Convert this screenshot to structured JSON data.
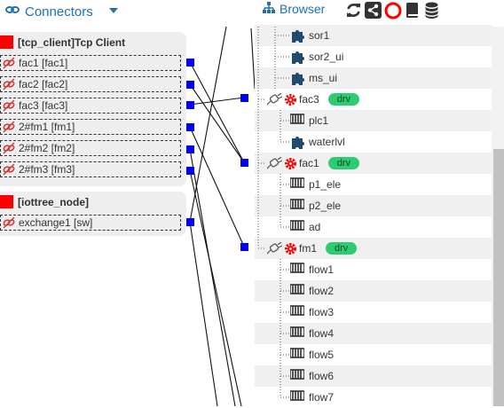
{
  "header": {
    "connectors_label": "Connectors",
    "browser_label": "Browser"
  },
  "connectors": [
    {
      "title": "[tcp_client]Tcp Client",
      "items": [
        "fac1 [fac1]",
        "fac2 [fac2]",
        "fac3 [fac3]",
        "2#fm1 [fm1]",
        "2#fm2 [fm2]",
        "2#fm3 [fm3]"
      ]
    },
    {
      "title": "[iottree_node]",
      "items": [
        "exchange1 [sw]"
      ]
    }
  ],
  "tree": [
    {
      "label": "sor1",
      "icon": "puzzle-icon"
    },
    {
      "label": "sor2_ui",
      "icon": "puzzle-icon"
    },
    {
      "label": "ms_ui",
      "icon": "puzzle-icon"
    },
    {
      "label": "fac3",
      "icon": "gear-icon",
      "badge": "drv"
    },
    {
      "label": "plc1",
      "icon": "device-icon"
    },
    {
      "label": "waterlvl",
      "icon": "puzzle-icon"
    },
    {
      "label": "fac1",
      "icon": "gear-icon",
      "badge": "drv"
    },
    {
      "label": "p1_ele",
      "icon": "device-icon"
    },
    {
      "label": "p2_ele",
      "icon": "device-icon"
    },
    {
      "label": "ad",
      "icon": "device-icon"
    },
    {
      "label": "fm1",
      "icon": "gear-icon",
      "badge": "drv"
    },
    {
      "label": "flow1",
      "icon": "device-icon"
    },
    {
      "label": "flow2",
      "icon": "device-icon"
    },
    {
      "label": "flow3",
      "icon": "device-icon"
    },
    {
      "label": "flow4",
      "icon": "device-icon"
    },
    {
      "label": "flow5",
      "icon": "device-icon"
    },
    {
      "label": "flow6",
      "icon": "device-icon"
    },
    {
      "label": "flow7",
      "icon": "device-icon"
    }
  ],
  "colors": {
    "accent": "#1f6fb5",
    "port": "#0000ee",
    "status_red": "#ff0000",
    "badge_green": "#2ecc71"
  }
}
